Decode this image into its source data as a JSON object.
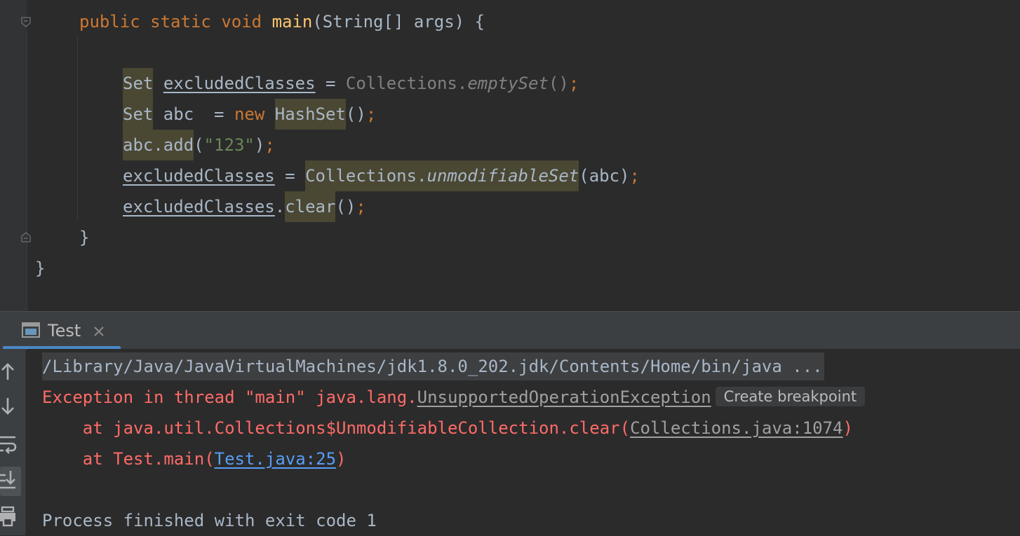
{
  "editor": {
    "lines": {
      "main_sig": {
        "kw1": "public",
        "kw2": "static",
        "kw3": "void",
        "name": "main",
        "params": "(String[] args) {"
      },
      "line1": {
        "type": "Set",
        "var": "excludedClasses",
        "eq": " = ",
        "cls": "Collections.",
        "method": "emptySet",
        "paren": "()",
        "semi": ";"
      },
      "line2": {
        "type": "Set",
        "rest": " abc  = ",
        "kw": "new",
        "cls": "HashSet",
        "paren": "()",
        "semi": ";"
      },
      "line3": {
        "call": "abc.add",
        "open": "(",
        "str": "\"123\"",
        "close": ")",
        "semi": ";"
      },
      "line4": {
        "var": "excludedClasses",
        "eq": " = ",
        "cls": "Collections.",
        "method": "unmodifiableSet",
        "args": "(abc)",
        "semi": ";"
      },
      "line5": {
        "var": "excludedClasses",
        "dot": ".",
        "method": "clear",
        "paren": "()",
        "semi": ";"
      },
      "close_inner": "}",
      "close_outer": "}"
    }
  },
  "run_panel": {
    "tab_label": "Test",
    "console": {
      "command": "/Library/Java/JavaVirtualMachines/jdk1.8.0_202.jdk/Contents/Home/bin/java ...",
      "exception_prefix": "Exception in thread \"main\" java.lang.",
      "exception_class": "UnsupportedOperationException",
      "breakpoint_button": "Create breakpoint",
      "trace1_prefix": "    at java.util.Collections$UnmodifiableCollection.clear(",
      "trace1_link": "Collections.java:1074",
      "trace1_suffix": ")",
      "trace2_prefix": "    at Test.main(",
      "trace2_link": "Test.java:25",
      "trace2_suffix": ")",
      "finish": "Process finished with exit code 1"
    }
  },
  "colors": {
    "keyword": "#cc7832",
    "function": "#ffc66d",
    "string": "#6a8759",
    "error": "#ff6b68",
    "link": "#589df6",
    "highlight": "#4a4733"
  },
  "icons": [
    "fold-icon",
    "console-tab-icon",
    "close-icon",
    "arrow-up-icon",
    "arrow-down-icon",
    "soft-wrap-icon",
    "scroll-to-end-icon",
    "print-icon"
  ]
}
